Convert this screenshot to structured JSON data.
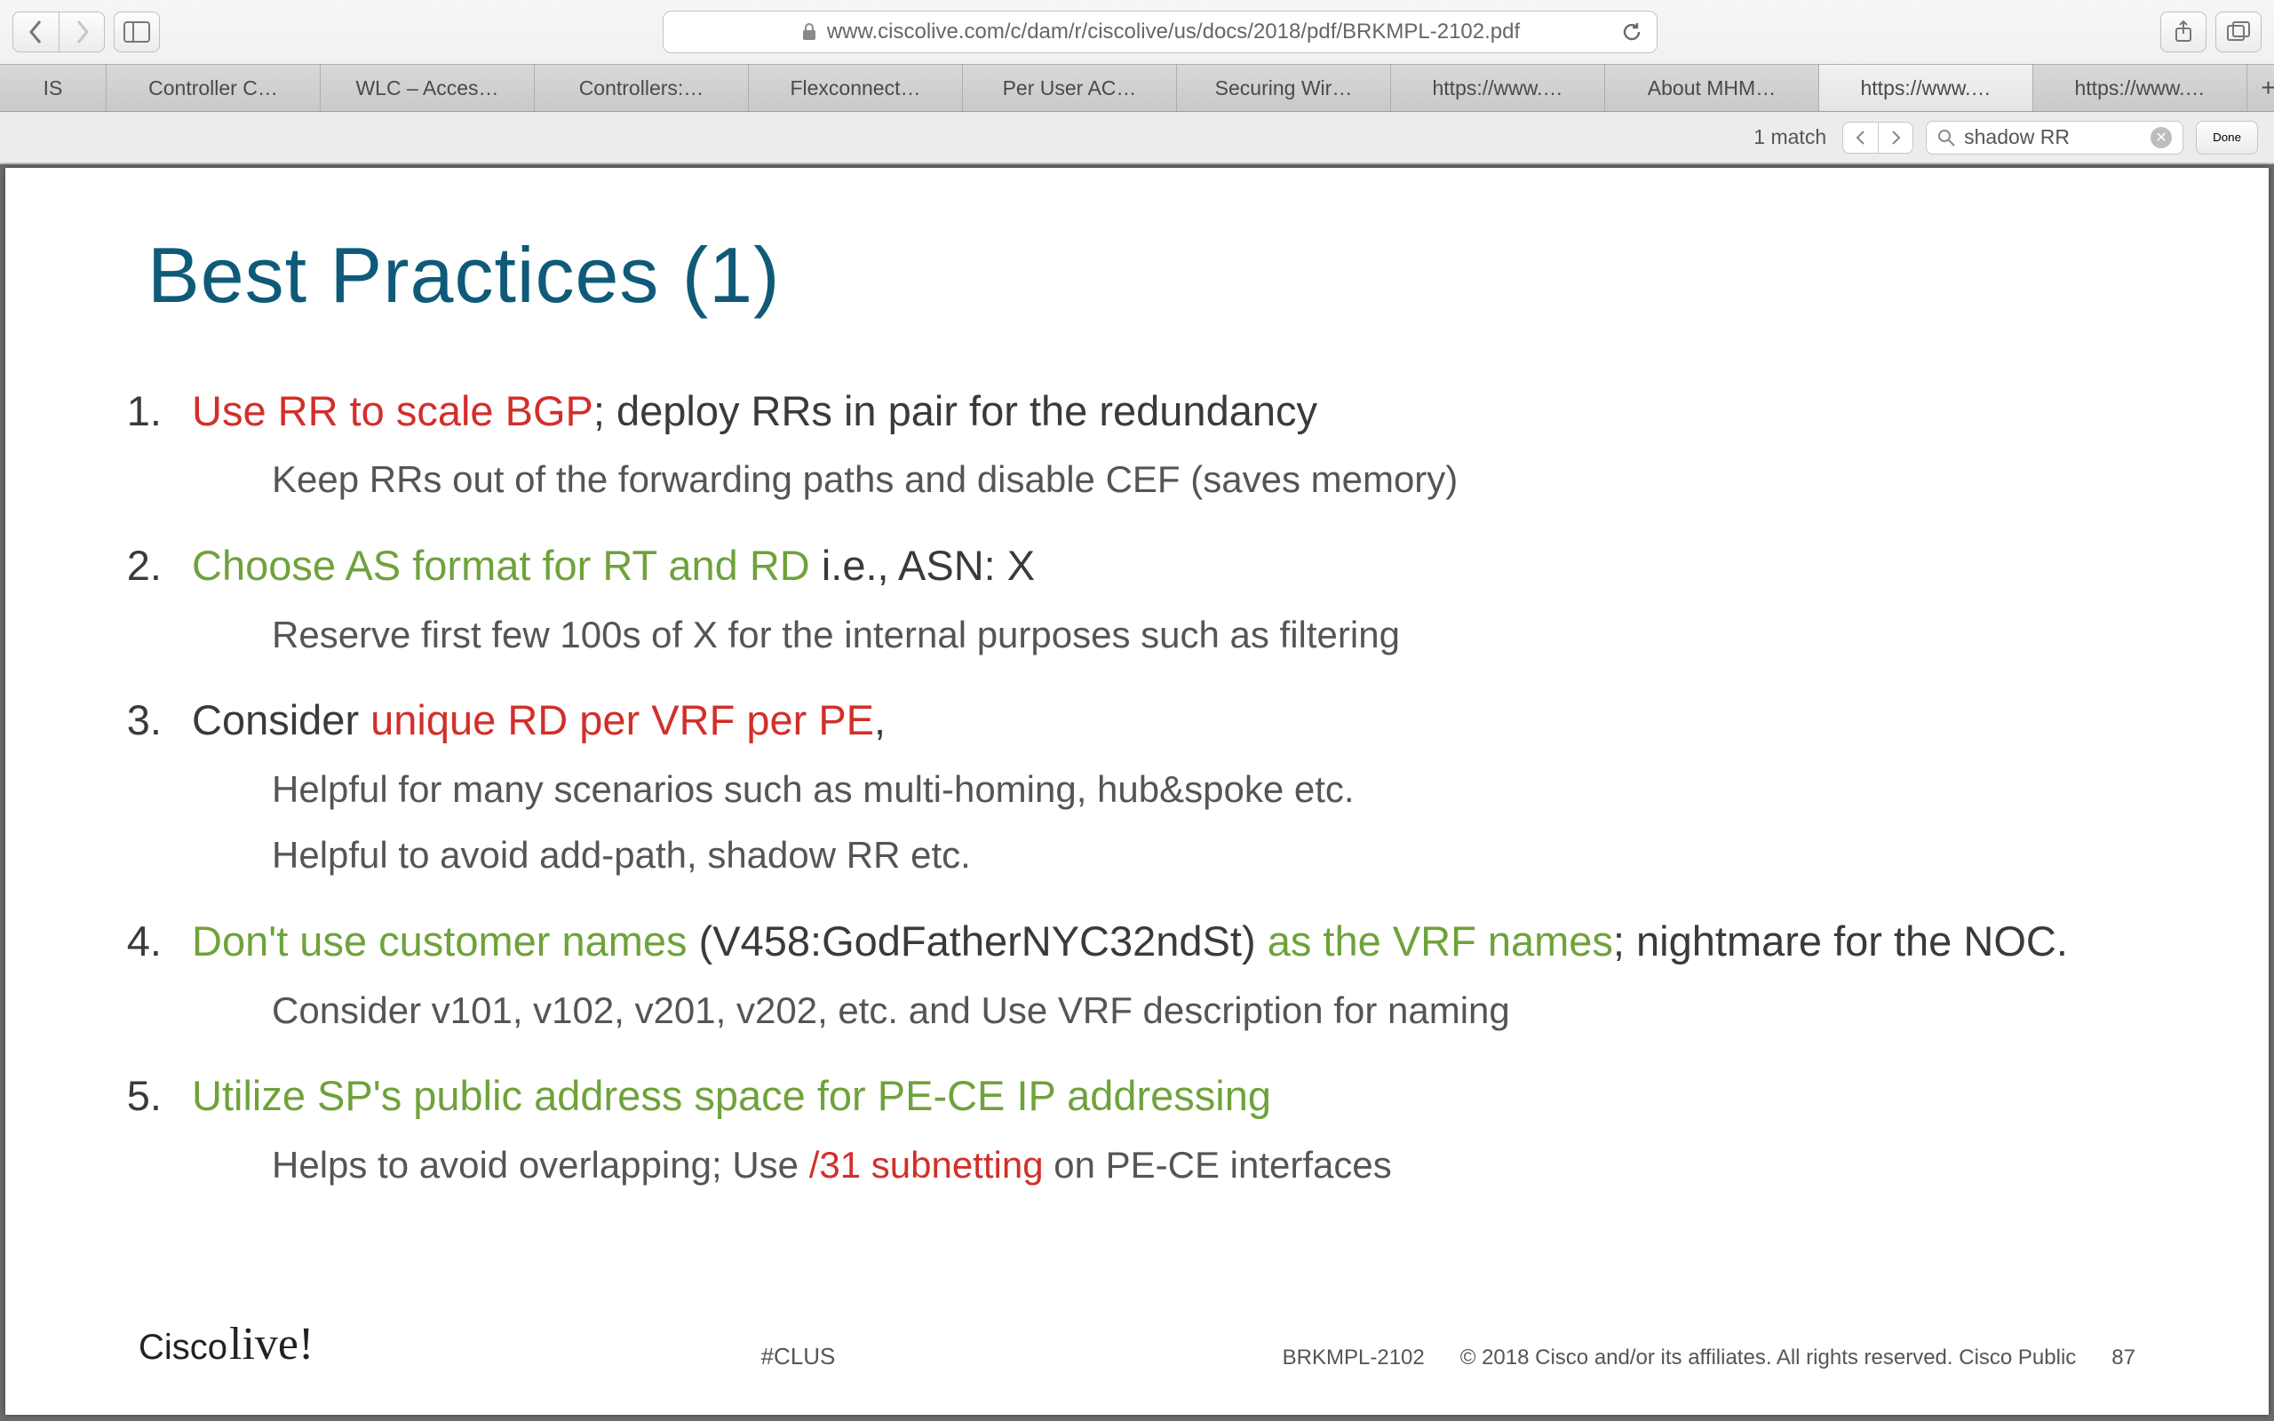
{
  "browser": {
    "url": "www.ciscolive.com/c/dam/r/ciscolive/us/docs/2018/pdf/BRKMPL-2102.pdf",
    "tabs": [
      "IS",
      "Controller C…",
      "WLC – Acces…",
      "Controllers:…",
      "Flexconnect…",
      "Per User AC…",
      "Securing Wir…",
      "https://www.…",
      "About MHM…",
      "https://www.…",
      "https://www.…"
    ],
    "active_tab_index": 9
  },
  "find": {
    "count_label": "1 match",
    "query": "shadow RR",
    "done_label": "Done"
  },
  "slide": {
    "title": "Best Practices (1)",
    "items": [
      {
        "num": "1.",
        "lead_red": "Use RR to scale BGP",
        "lead_tail": "; deploy RRs in pair for the redundancy",
        "subs": [
          "Keep RRs out of the forwarding paths and disable CEF (saves memory)"
        ]
      },
      {
        "num": "2.",
        "lead_green": "Choose AS format for RT and RD",
        "lead_tail": " i.e., ASN: X",
        "subs": [
          "Reserve first few 100s of X for the internal purposes such as filtering"
        ]
      },
      {
        "num": "3.",
        "lead_plain_pre": "Consider ",
        "lead_red": "unique RD per VRF per PE",
        "lead_tail": ",",
        "subs": [
          "Helpful for many scenarios such as multi-homing, hub&spoke etc.",
          "Helpful to avoid add-path, shadow RR etc."
        ]
      },
      {
        "num": "4.",
        "lead_green": "Don't use customer names",
        "lead_mid_plain": " (V458:GodFatherNYC32ndSt) ",
        "lead_green2": "as the VRF names",
        "lead_tail": "; nightmare for the NOC.",
        "subs": [
          "Consider v101, v102, v201, v202, etc. and Use VRF description for naming"
        ]
      },
      {
        "num": "5.",
        "lead_green": "Utilize SP's public address space for PE-CE IP addressing",
        "subs_mixed": {
          "pre": "Helps to avoid overlapping; Use ",
          "red": "/31 subnetting",
          "post": " on PE-CE interfaces"
        }
      }
    ],
    "footer": {
      "hashtag": "#CLUS",
      "code": "BRKMPL-2102",
      "copyright": "© 2018  Cisco and/or its affiliates. All rights reserved.   Cisco Public",
      "page_num": "87",
      "logo_brand": "Cisco",
      "logo_script": "live!"
    }
  }
}
